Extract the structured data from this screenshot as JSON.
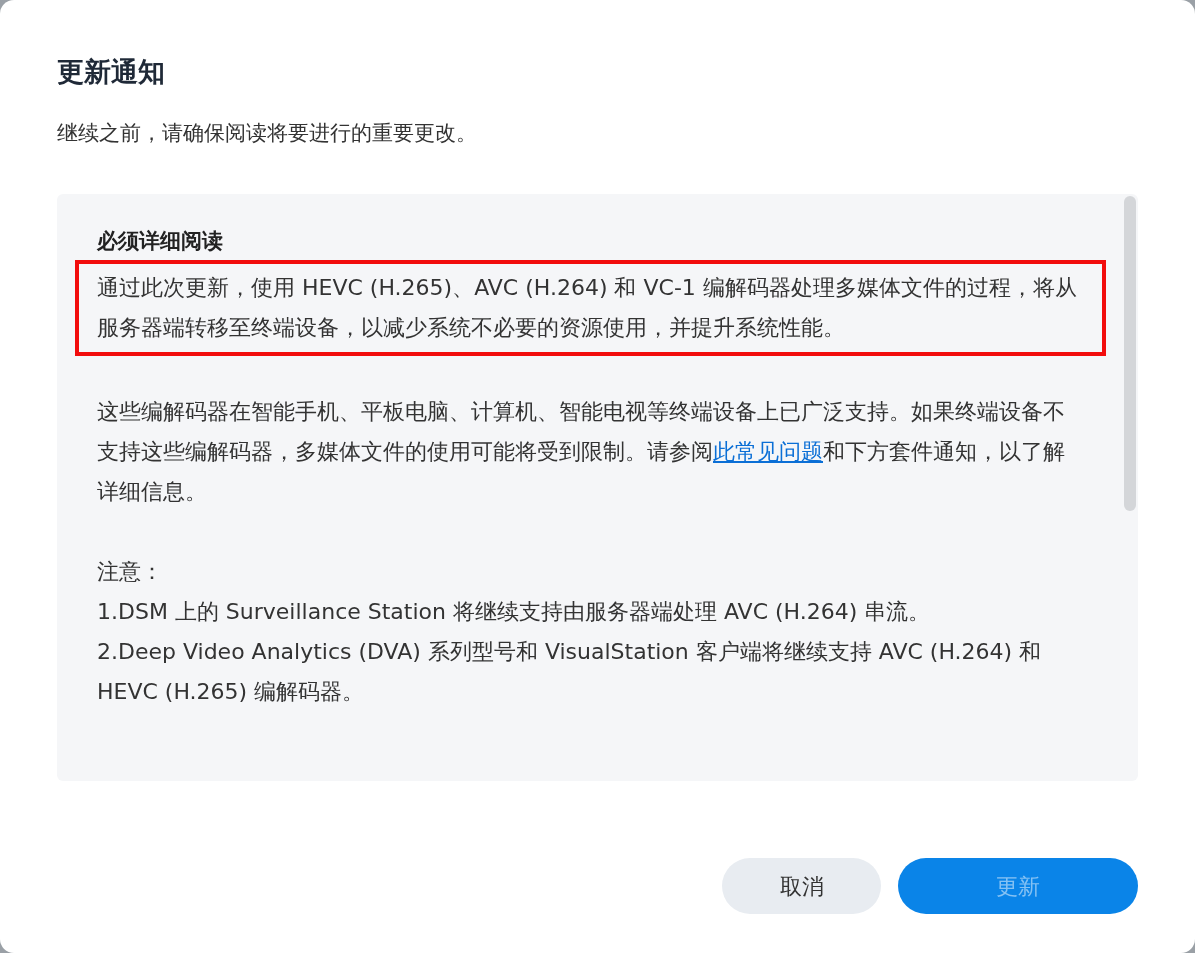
{
  "dialog": {
    "title": "更新通知",
    "subtitle": "继续之前，请确保阅读将要进行的重要更改。"
  },
  "notice": {
    "heading": "必须详细阅读",
    "highlighted": "通过此次更新，使用 HEVC (H.265)、AVC (H.264) 和 VC-1 编解码器处理多媒体文件的过程，将从服务器端转移至终端设备，以减少系统不必要的资源使用，并提升系统性能。",
    "paragraph_before": "这些编解码器在智能手机、平板电脑、计算机、智能电视等终端设备上已广泛支持。如果终端设备不支持这些编解码器，多媒体文件的使用可能将受到限制。请参阅",
    "link": "此常见问题",
    "paragraph_after": "和下方套件通知，以了解详细信息。",
    "note_label": "注意：",
    "notes": [
      "1.DSM 上的 Surveillance Station 将继续支持由服务器端处理 AVC (H.264) 串流。",
      "2.Deep Video Analytics (DVA) 系列型号和 VisualStation 客户端将继续支持 AVC (H.264) 和 HEVC (H.265) 编解码器。"
    ]
  },
  "buttons": [
    {
      "label": "取消",
      "kind": "secondary",
      "disabled": false
    },
    {
      "label": "更新",
      "kind": "primary",
      "disabled": true
    }
  ]
}
